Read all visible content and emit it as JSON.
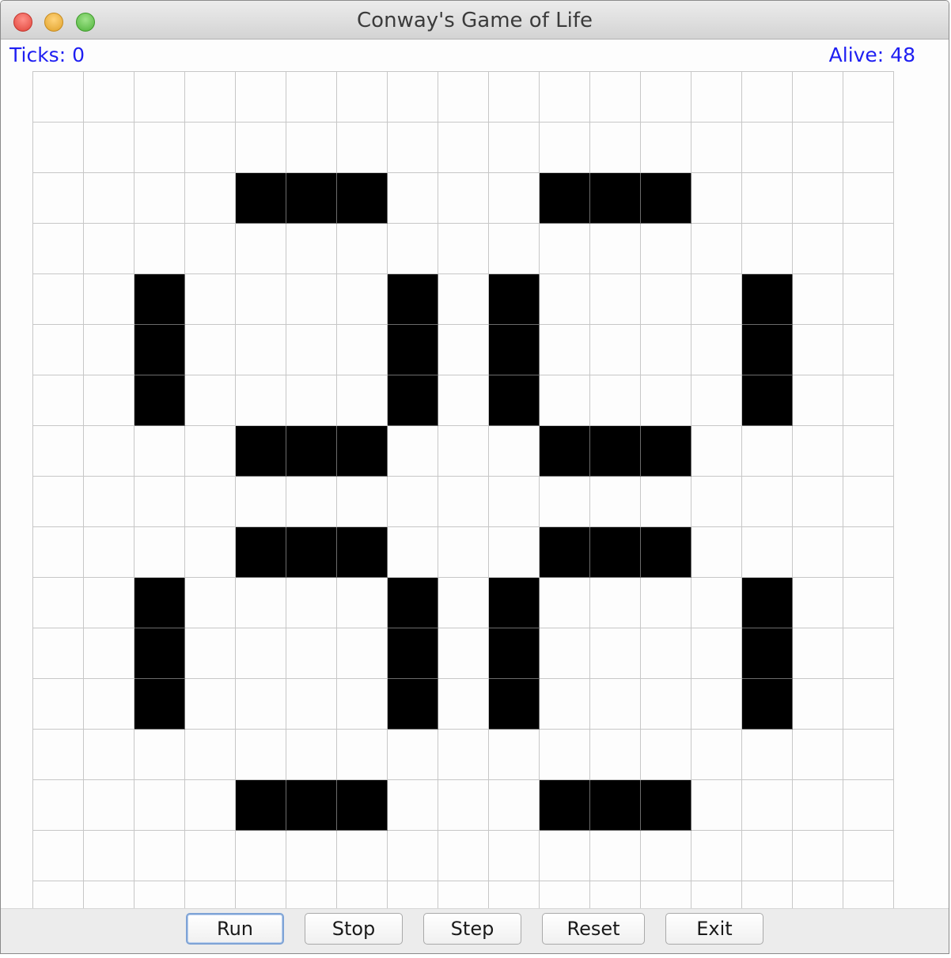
{
  "window": {
    "title": "Conway's Game of Life"
  },
  "status": {
    "ticks": "Ticks: 0",
    "alive": "Alive: 48"
  },
  "grid": {
    "rows": 17,
    "cols": 17,
    "alive_cells": [
      [
        2,
        4
      ],
      [
        2,
        5
      ],
      [
        2,
        6
      ],
      [
        2,
        10
      ],
      [
        2,
        11
      ],
      [
        2,
        12
      ],
      [
        4,
        2
      ],
      [
        4,
        7
      ],
      [
        4,
        9
      ],
      [
        4,
        14
      ],
      [
        5,
        2
      ],
      [
        5,
        7
      ],
      [
        5,
        9
      ],
      [
        5,
        14
      ],
      [
        6,
        2
      ],
      [
        6,
        7
      ],
      [
        6,
        9
      ],
      [
        6,
        14
      ],
      [
        7,
        4
      ],
      [
        7,
        5
      ],
      [
        7,
        6
      ],
      [
        7,
        10
      ],
      [
        7,
        11
      ],
      [
        7,
        12
      ],
      [
        9,
        4
      ],
      [
        9,
        5
      ],
      [
        9,
        6
      ],
      [
        9,
        10
      ],
      [
        9,
        11
      ],
      [
        9,
        12
      ],
      [
        10,
        2
      ],
      [
        10,
        7
      ],
      [
        10,
        9
      ],
      [
        10,
        14
      ],
      [
        11,
        2
      ],
      [
        11,
        7
      ],
      [
        11,
        9
      ],
      [
        11,
        14
      ],
      [
        12,
        2
      ],
      [
        12,
        7
      ],
      [
        12,
        9
      ],
      [
        12,
        14
      ],
      [
        14,
        4
      ],
      [
        14,
        5
      ],
      [
        14,
        6
      ],
      [
        14,
        10
      ],
      [
        14,
        11
      ],
      [
        14,
        12
      ]
    ],
    "alive_color": "#000000",
    "dead_color": "#fdfdfd",
    "line_color": "#c7c7c7"
  },
  "buttons": {
    "run": "Run",
    "stop": "Stop",
    "step": "Step",
    "reset": "Reset",
    "exit": "Exit"
  },
  "colors": {
    "status_text": "#1e1ef2"
  }
}
